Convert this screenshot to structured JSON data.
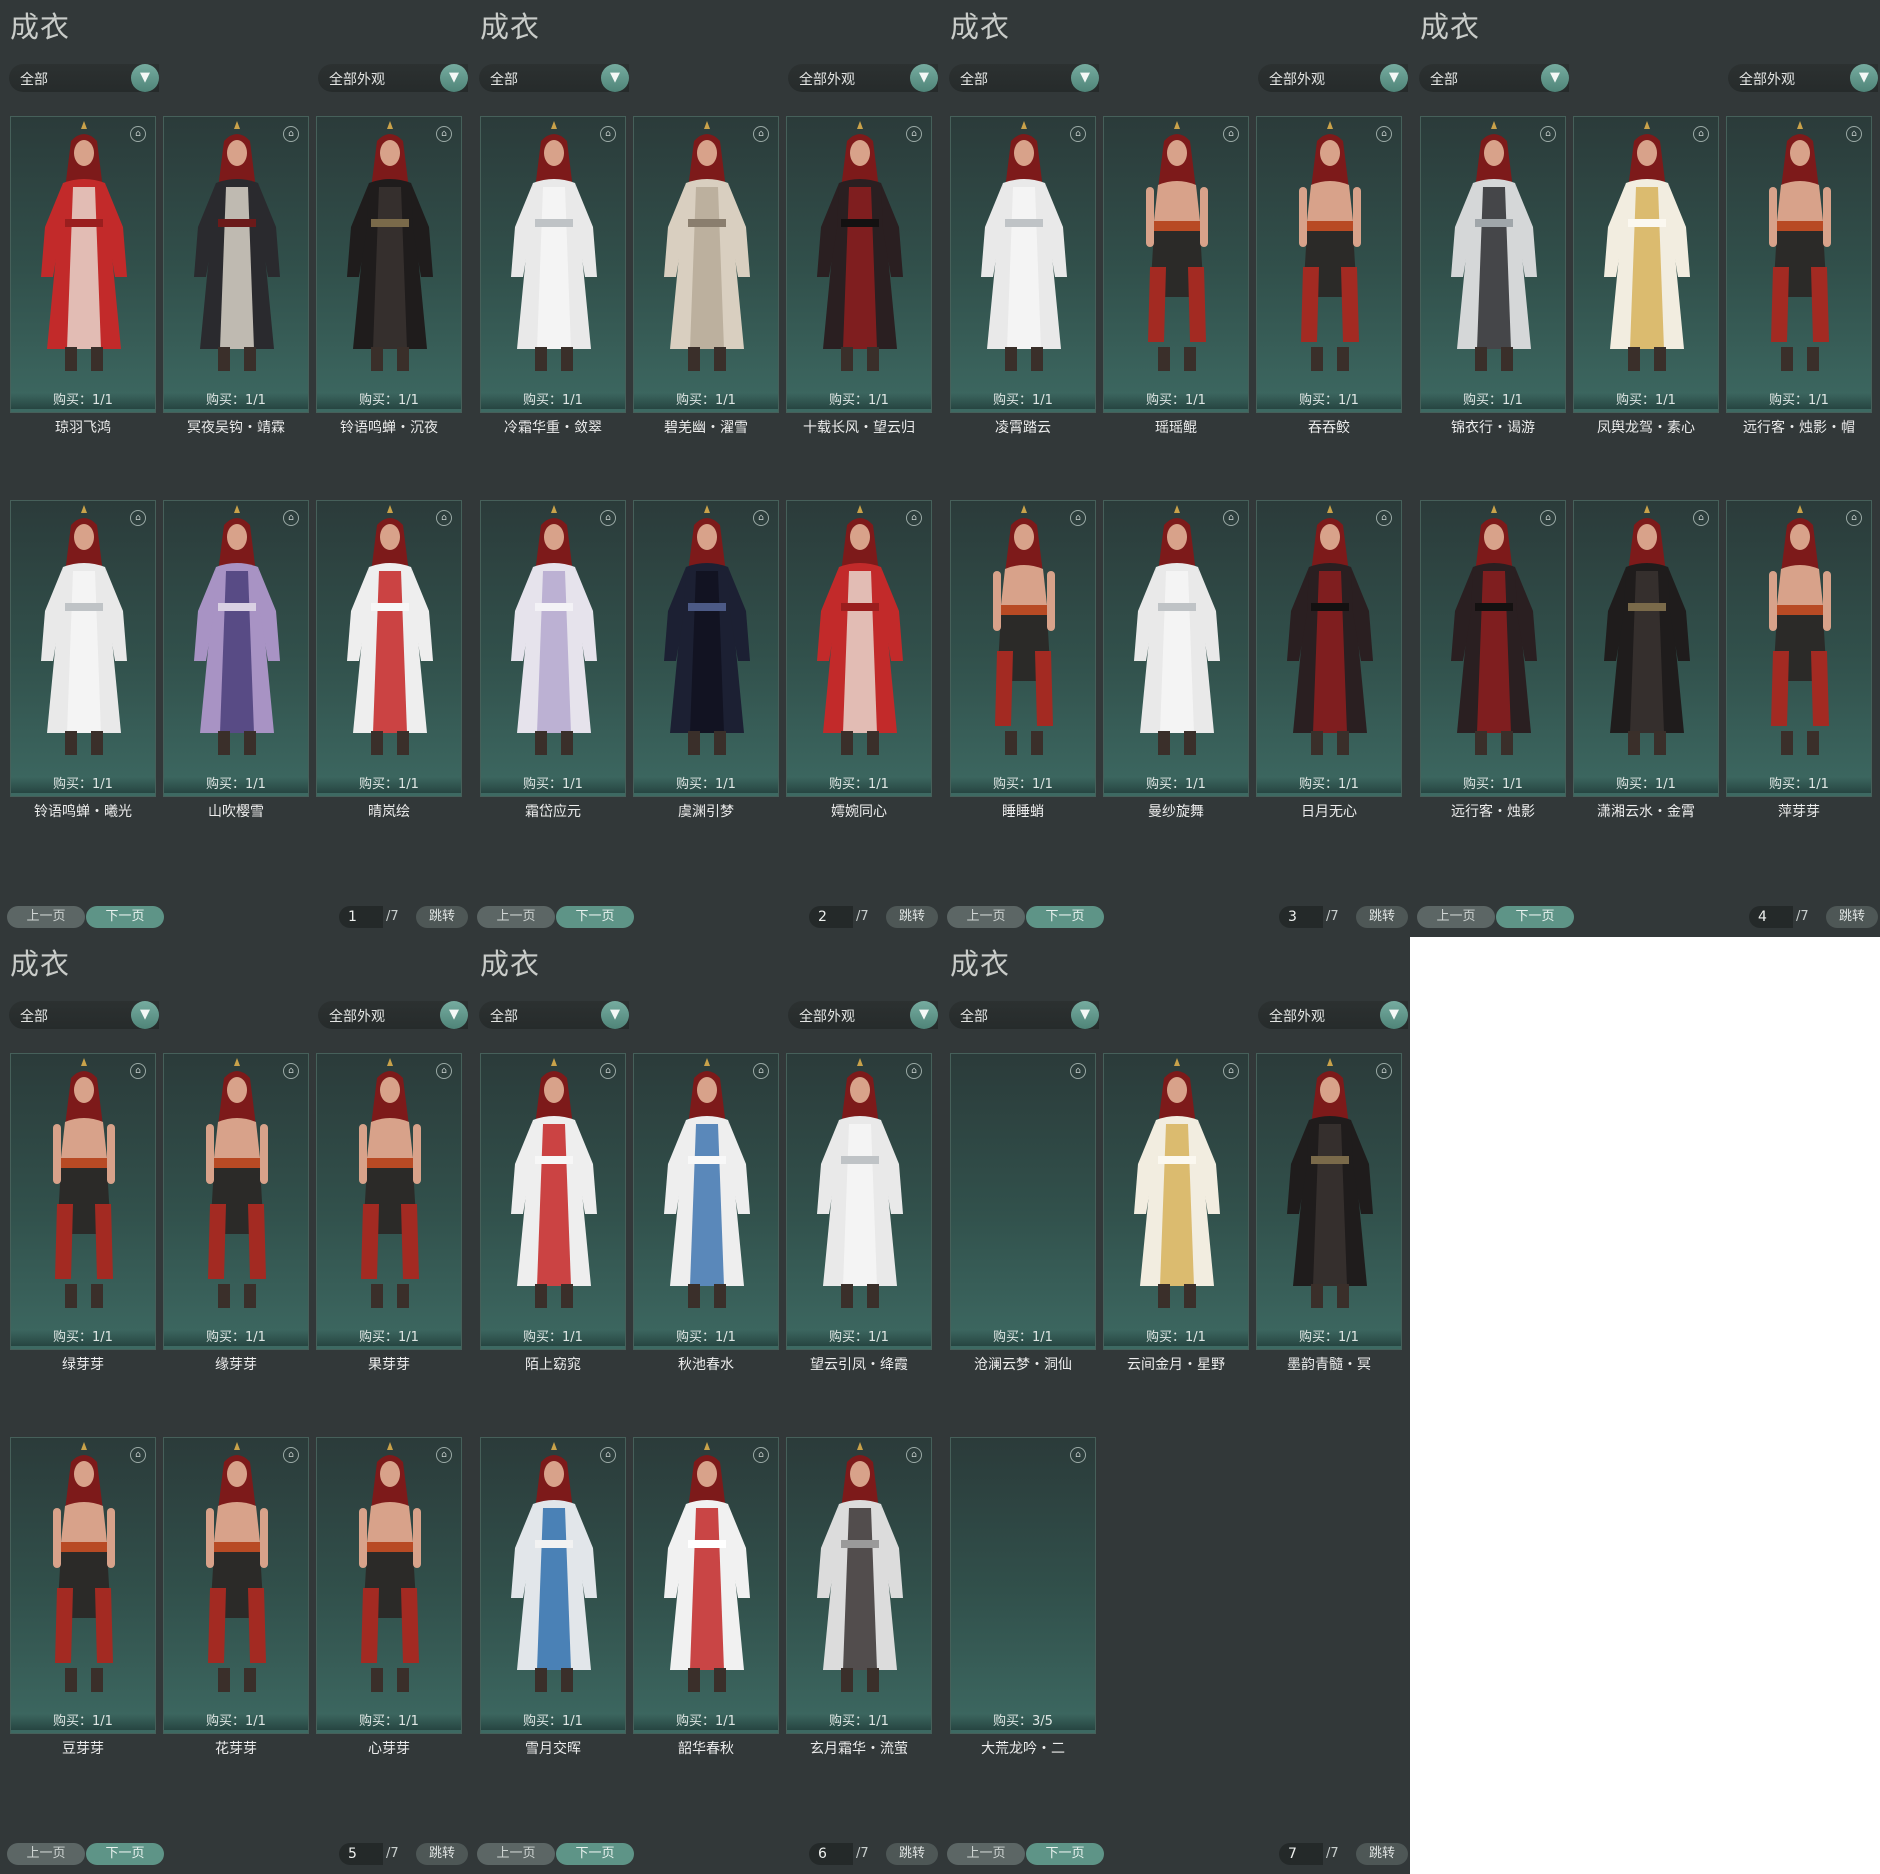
{
  "common": {
    "title": "成衣",
    "filter_left": "全部",
    "filter_right": "全部外观",
    "prev_label": "上一页",
    "next_label": "下一页",
    "jump_label": "跳转",
    "total_pages": "/7",
    "dropdown_icon": "chevron-down-icon",
    "colors": {
      "accent": "#5e9487",
      "panel_bg": "#323839",
      "card_bg": "#31504b"
    }
  },
  "panels": [
    {
      "page": "1",
      "items": [
        {
          "name": "琼羽飞鸿",
          "buy": "购买：1/1",
          "look": "red"
        },
        {
          "name": "冥夜吴钩・靖霖",
          "buy": "购买：1/1",
          "look": "dark"
        },
        {
          "name": "铃语鸣蝉・沉夜",
          "buy": "购买：1/1",
          "look": "black"
        },
        {
          "name": "铃语鸣蝉・曦光",
          "buy": "购买：1/1",
          "look": "white"
        },
        {
          "name": "山吹樱雪",
          "buy": "购买：1/1",
          "look": "purple"
        },
        {
          "name": "晴岚绘",
          "buy": "购买：1/1",
          "look": "whitered"
        }
      ]
    },
    {
      "page": "2",
      "items": [
        {
          "name": "冷霜华重・敛翠",
          "buy": "购买：1/1",
          "look": "white"
        },
        {
          "name": "碧羌幽・濯雪",
          "buy": "购买：1/1",
          "look": "beige"
        },
        {
          "name": "十载长风・望云归",
          "buy": "购买：1/1",
          "look": "darkred"
        },
        {
          "name": "霜岱应元",
          "buy": "购买：1/1",
          "look": "lavender"
        },
        {
          "name": "虞渊引梦",
          "buy": "购买：1/1",
          "look": "navy"
        },
        {
          "name": "嫮婉同心",
          "buy": "购买：1/1",
          "look": "red"
        }
      ]
    },
    {
      "page": "3",
      "items": [
        {
          "name": "凌霄踏云",
          "buy": "购买：1/1",
          "look": "white"
        },
        {
          "name": "瑶瑶鲲",
          "buy": "购买：1/1",
          "look": "shirtless"
        },
        {
          "name": "吞吞鲛",
          "buy": "购买：1/1",
          "look": "shirtless"
        },
        {
          "name": "睡睡蛸",
          "buy": "购买：1/1",
          "look": "shirtless"
        },
        {
          "name": "曼纱旋舞",
          "buy": "购买：1/1",
          "look": "white"
        },
        {
          "name": "日月无心",
          "buy": "购买：1/1",
          "look": "darkred"
        }
      ]
    },
    {
      "page": "4",
      "items": [
        {
          "name": "锦衣行・谒游",
          "buy": "购买：1/1",
          "look": "greywhite"
        },
        {
          "name": "凤舆龙驾・素心",
          "buy": "购买：1/1",
          "look": "gold"
        },
        {
          "name": "远行客・烛影・帽",
          "buy": "购买：1/1",
          "look": "shirtless"
        },
        {
          "name": "远行客・烛影",
          "buy": "购买：1/1",
          "look": "darkred"
        },
        {
          "name": "潇湘云水・金霄",
          "buy": "购买：1/1",
          "look": "black"
        },
        {
          "name": "萍芽芽",
          "buy": "购买：1/1",
          "look": "shirtless"
        }
      ]
    },
    {
      "page": "5",
      "items": [
        {
          "name": "绿芽芽",
          "buy": "购买：1/1",
          "look": "shirtless"
        },
        {
          "name": "缘芽芽",
          "buy": "购买：1/1",
          "look": "shirtless"
        },
        {
          "name": "果芽芽",
          "buy": "购买：1/1",
          "look": "shirtless"
        },
        {
          "name": "豆芽芽",
          "buy": "购买：1/1",
          "look": "shirtless"
        },
        {
          "name": "花芽芽",
          "buy": "购买：1/1",
          "look": "shirtless"
        },
        {
          "name": "心芽芽",
          "buy": "购买：1/1",
          "look": "shirtless"
        }
      ]
    },
    {
      "page": "6",
      "items": [
        {
          "name": "陌上窈窕",
          "buy": "购买：1/1",
          "look": "whitered"
        },
        {
          "name": "秋池春水",
          "buy": "购买：1/1",
          "look": "whiteblue"
        },
        {
          "name": "望云引凤・绛霞",
          "buy": "购买：1/1",
          "look": "white"
        },
        {
          "name": "雪月交晖",
          "buy": "购买：1/1",
          "look": "blue"
        },
        {
          "name": "韶华春秋",
          "buy": "购买：1/1",
          "look": "redwhite"
        },
        {
          "name": "玄月霜华・流萤",
          "buy": "购买：1/1",
          "look": "silver"
        }
      ]
    },
    {
      "page": "7",
      "items": [
        {
          "name": "沧澜云梦・洞仙",
          "buy": "购买：1/1",
          "look": "empty"
        },
        {
          "name": "云间金月・星野",
          "buy": "购买：1/1",
          "look": "gold"
        },
        {
          "name": "墨韵青髓・冥",
          "buy": "购买：1/1",
          "look": "black"
        },
        {
          "name": "大荒龙吟・二",
          "buy": "购买：3/5",
          "look": "empty"
        }
      ]
    }
  ]
}
